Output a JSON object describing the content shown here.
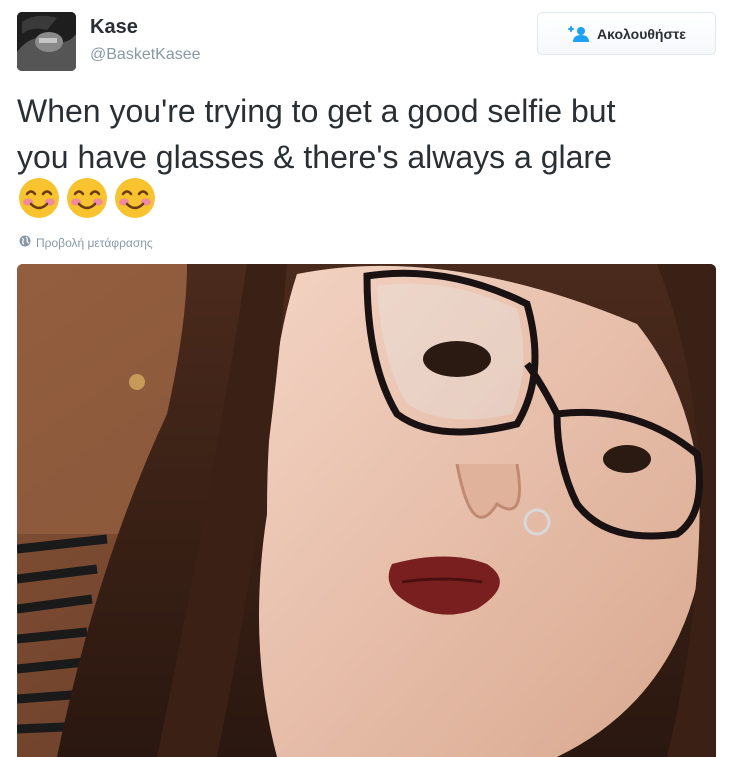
{
  "user": {
    "name": "Kase",
    "handle": "@BasketKasee"
  },
  "follow_button": {
    "label": "Ακολουθήστε",
    "icon": "add-user-icon"
  },
  "tweet": {
    "text_lines": [
      "When you're trying to get a good selfie but",
      "you have glasses & there's always a glare"
    ],
    "emojis": [
      "smiling-face-emoji",
      "smiling-face-emoji",
      "smiling-face-emoji"
    ]
  },
  "translate": {
    "label": "Προβολή μετάφρασης",
    "icon": "globe-icon"
  },
  "media": {
    "description_icon": "selfie-photo"
  },
  "colors": {
    "text": "#292f33",
    "muted": "#8899a6",
    "border": "#e1e8ed",
    "follow_icon": "#1da1f2"
  }
}
